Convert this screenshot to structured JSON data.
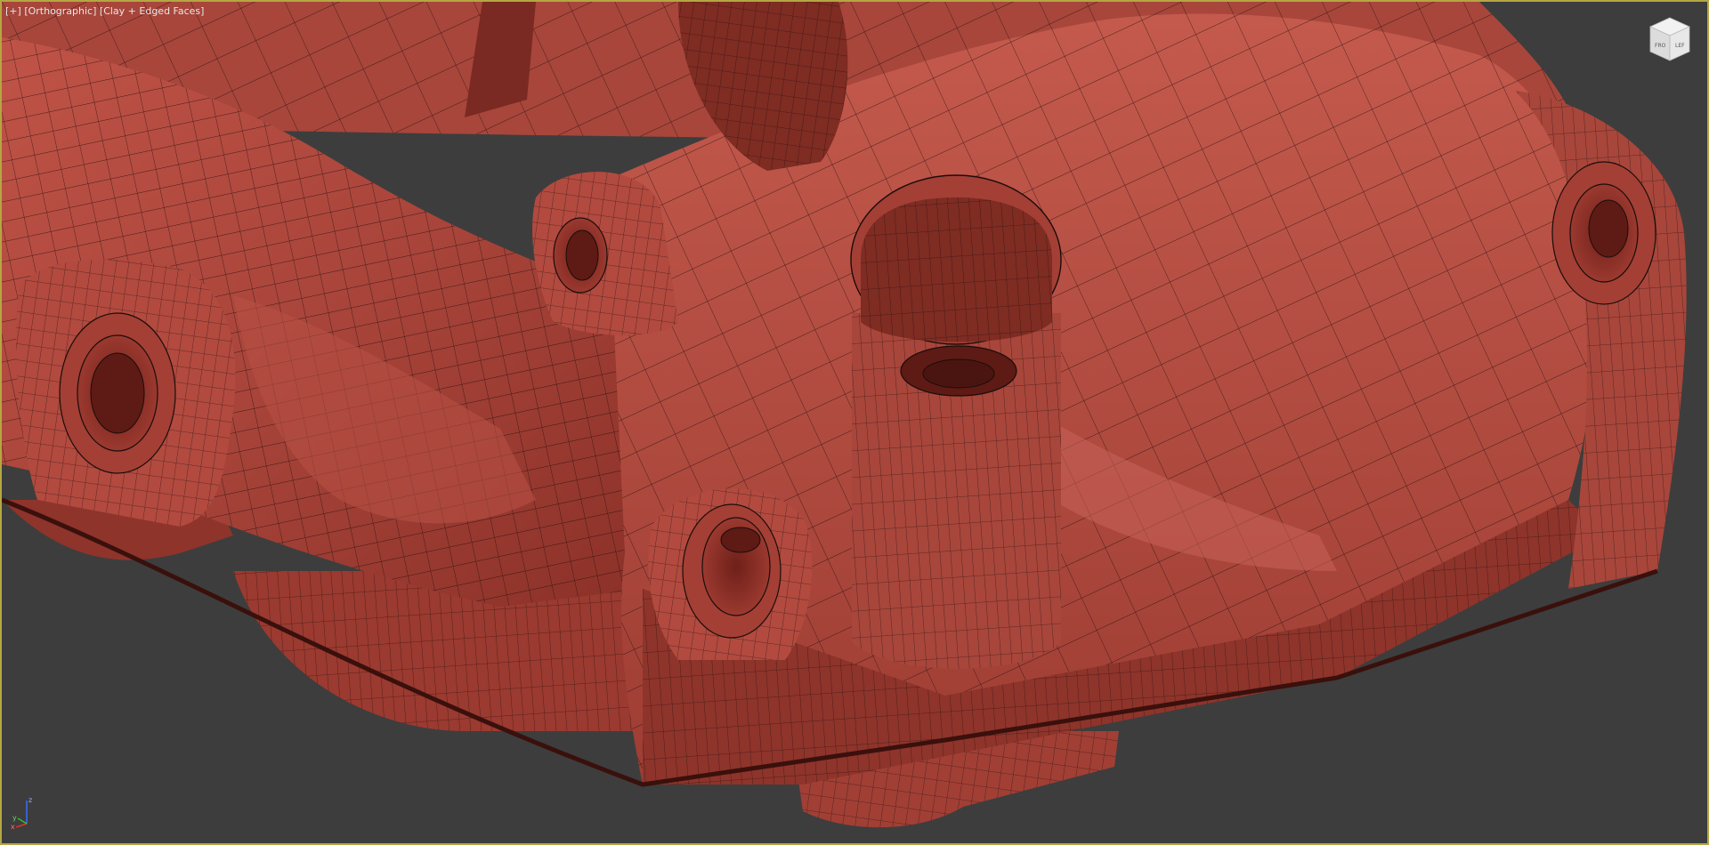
{
  "viewport": {
    "label_parts": [
      "[+]",
      "[Orthographic]",
      "[Clay + Edged Faces]"
    ],
    "viewcube": {
      "top_face": "",
      "front_face": "FRO",
      "side_face": "LEF"
    },
    "axis_labels": {
      "x": "x",
      "y": "y",
      "z": "z"
    }
  },
  "colors": {
    "background": "#3d3d3d",
    "frame": "#b5a642",
    "clay": "#b34a3d",
    "clay_dark": "#7a2a22",
    "clay_light": "#c8635a",
    "wire": "#1a0d0b"
  }
}
